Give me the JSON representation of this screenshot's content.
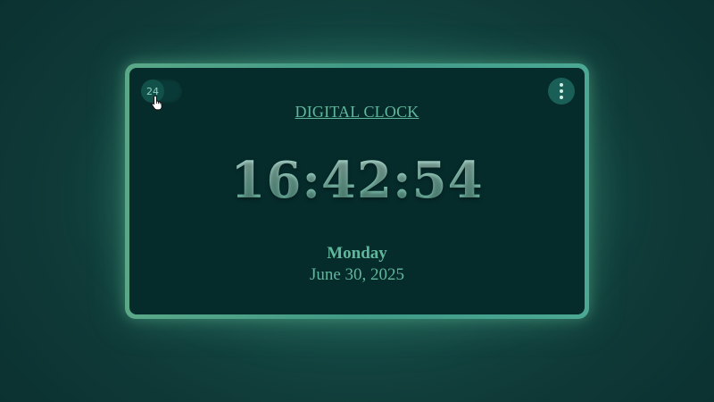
{
  "clock": {
    "title": "DIGITAL CLOCK",
    "time": "16:42:54",
    "day": "Monday",
    "date": "June 30, 2025",
    "format_toggle_label": "24"
  },
  "icons": {
    "menu": "vertical-dots-icon",
    "cursor": "hand-pointer-icon"
  },
  "colors": {
    "background": "#0f3a38",
    "panel": "#062b2b",
    "frame": "#4aa886",
    "accent": "#5fb89c",
    "digits": "#8ccfbe"
  }
}
